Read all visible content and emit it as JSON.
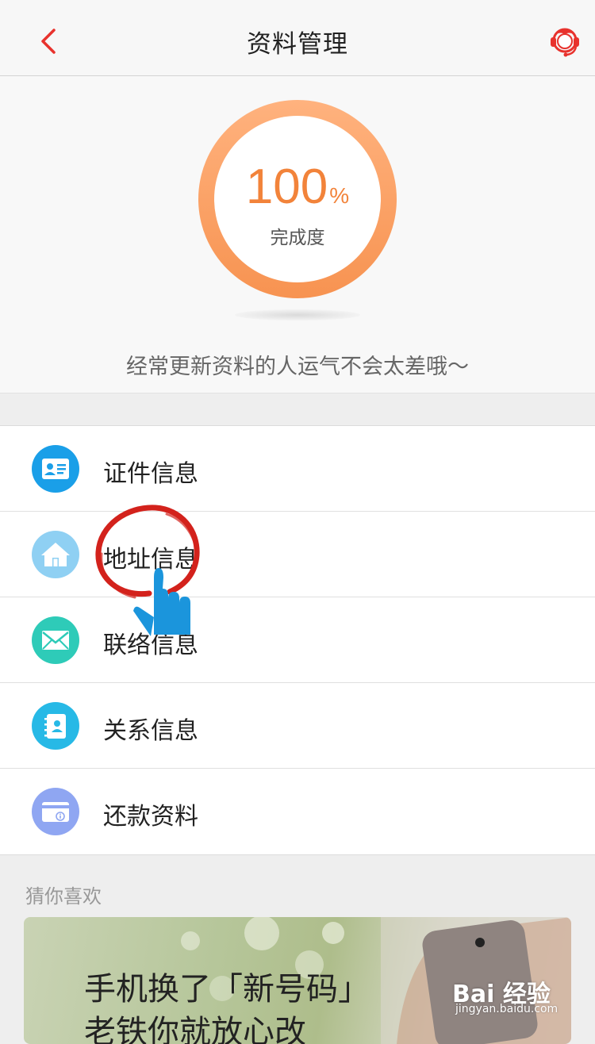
{
  "header": {
    "title": "资料管理",
    "back_icon": "chevron-left-icon",
    "service_icon": "customer-service-icon",
    "accent_color": "#e8322d"
  },
  "progress": {
    "percent_value": "100",
    "percent_unit": "%",
    "label": "完成度",
    "fraction": 1.0,
    "ring_color": "#f6a064"
  },
  "slogan": "经常更新资料的人运气不会太差哦～",
  "menu": {
    "items": [
      {
        "label": "证件信息",
        "icon": "id-card-icon",
        "color": "#1a9fe8"
      },
      {
        "label": "地址信息",
        "icon": "home-icon",
        "color": "#8fd0f3"
      },
      {
        "label": "联络信息",
        "icon": "envelope-icon",
        "color": "#2ecbb8"
      },
      {
        "label": "关系信息",
        "icon": "contacts-book-icon",
        "color": "#27b9e6"
      },
      {
        "label": "还款资料",
        "icon": "bank-card-icon",
        "color": "#8fa6f2"
      }
    ]
  },
  "recommend": {
    "title": "猜你喜欢",
    "banner_line1": "手机换了「新号码」",
    "banner_line2": "老铁你就放心改"
  },
  "watermark": {
    "text": "Bai 经验",
    "sub": "jingyan.baidu.com"
  }
}
